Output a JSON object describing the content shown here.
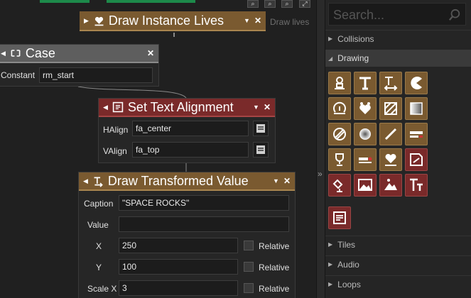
{
  "blocks": {
    "draw_instance_lives": {
      "title": "Draw Instance Lives",
      "hint": "Draw lives"
    },
    "case": {
      "title": "Case",
      "field_label": "Constant",
      "field_value": "rm_start"
    },
    "set_text_alignment": {
      "title": "Set Text Alignment",
      "halign_label": "HAlign",
      "halign_value": "fa_center",
      "valign_label": "VAlign",
      "valign_value": "fa_top"
    },
    "draw_transformed_value": {
      "title": "Draw Transformed Value",
      "caption_label": "Caption",
      "caption_value": "\"SPACE ROCKS\"",
      "value_label": "Value",
      "value_value": "",
      "x_label": "X",
      "x_value": "250",
      "y_label": "Y",
      "y_value": "100",
      "scalex_label": "Scale X",
      "scalex_value": "3",
      "relative_label": "Relative"
    }
  },
  "toolbox": {
    "search_placeholder": "Search...",
    "sections": {
      "collisions": "Collisions",
      "drawing": "Drawing",
      "tiles": "Tiles",
      "audio": "Audio",
      "loops": "Loops"
    }
  },
  "colors": {
    "orange": "#7a5a30",
    "red": "#7a2a2a",
    "gray": "#5e5e5e"
  }
}
